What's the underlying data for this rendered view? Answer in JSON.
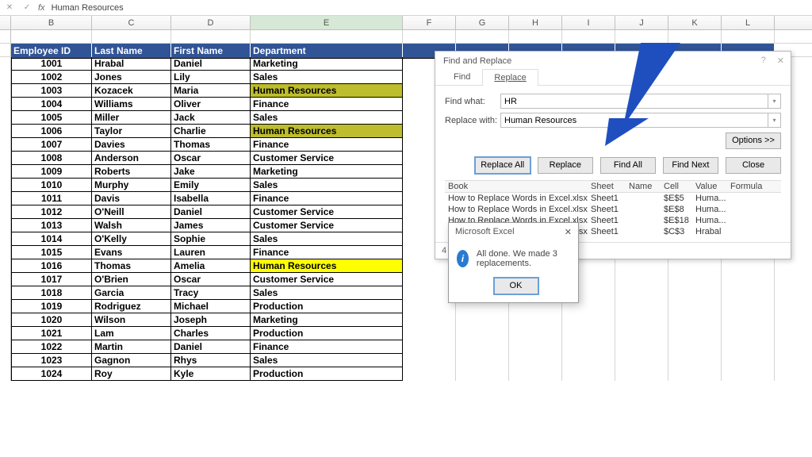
{
  "formula_bar": {
    "text": "Human Resources"
  },
  "columns": [
    "B",
    "C",
    "D",
    "E",
    "F",
    "G",
    "H",
    "I",
    "J",
    "K",
    "L"
  ],
  "headers": {
    "b": "Employee ID",
    "c": "Last Name",
    "d": "First Name",
    "e": "Department"
  },
  "rows": [
    {
      "id": "1001",
      "last": "Hrabal",
      "first": "Daniel",
      "dept": "Marketing"
    },
    {
      "id": "1002",
      "last": "Jones",
      "first": "Lily",
      "dept": "Sales"
    },
    {
      "id": "1003",
      "last": "Kozacek",
      "first": "Maria",
      "dept": "Human Resources",
      "hl": "olive"
    },
    {
      "id": "1004",
      "last": "Williams",
      "first": "Oliver",
      "dept": "Finance"
    },
    {
      "id": "1005",
      "last": "Miller",
      "first": "Jack",
      "dept": "Sales"
    },
    {
      "id": "1006",
      "last": "Taylor",
      "first": "Charlie",
      "dept": "Human Resources",
      "hl": "olive"
    },
    {
      "id": "1007",
      "last": "Davies",
      "first": "Thomas",
      "dept": "Finance"
    },
    {
      "id": "1008",
      "last": "Anderson",
      "first": "Oscar",
      "dept": "Customer Service"
    },
    {
      "id": "1009",
      "last": "Roberts",
      "first": "Jake",
      "dept": "Marketing"
    },
    {
      "id": "1010",
      "last": "Murphy",
      "first": "Emily",
      "dept": "Sales"
    },
    {
      "id": "1011",
      "last": "Davis",
      "first": "Isabella",
      "dept": "Finance"
    },
    {
      "id": "1012",
      "last": "O'Neill",
      "first": "Daniel",
      "dept": "Customer Service"
    },
    {
      "id": "1013",
      "last": "Walsh",
      "first": "James",
      "dept": "Customer Service"
    },
    {
      "id": "1014",
      "last": "O'Kelly",
      "first": "Sophie",
      "dept": "Sales"
    },
    {
      "id": "1015",
      "last": "Evans",
      "first": "Lauren",
      "dept": "Finance"
    },
    {
      "id": "1016",
      "last": "Thomas",
      "first": "Amelia",
      "dept": "Human Resources",
      "hl": "yellow"
    },
    {
      "id": "1017",
      "last": "O'Brien",
      "first": "Oscar",
      "dept": "Customer Service"
    },
    {
      "id": "1018",
      "last": "Garcia",
      "first": "Tracy",
      "dept": "Sales"
    },
    {
      "id": "1019",
      "last": "Rodriguez",
      "first": "Michael",
      "dept": "Production"
    },
    {
      "id": "1020",
      "last": "Wilson",
      "first": "Joseph",
      "dept": "Marketing"
    },
    {
      "id": "1021",
      "last": "Lam",
      "first": "Charles",
      "dept": "Production"
    },
    {
      "id": "1022",
      "last": "Martin",
      "first": "Daniel",
      "dept": "Finance"
    },
    {
      "id": "1023",
      "last": "Gagnon",
      "first": "Rhys",
      "dept": "Sales"
    },
    {
      "id": "1024",
      "last": "Roy",
      "first": "Kyle",
      "dept": "Production"
    }
  ],
  "dialog": {
    "title": "Find and Replace",
    "tab_find": "Find",
    "tab_replace": "Replace",
    "find_label": "Find what:",
    "find_value": "HR",
    "replace_label": "Replace with:",
    "replace_value": "Human Resources",
    "options": "Options >>",
    "btn_replace_all": "Replace All",
    "btn_replace": "Replace",
    "btn_find_all": "Find All",
    "btn_find_next": "Find Next",
    "btn_close": "Close",
    "footer": "4 cell(s) ",
    "cols": {
      "book": "Book",
      "sheet": "Sheet",
      "name": "Name",
      "cell": "Cell",
      "value": "Value",
      "formula": "Formula"
    },
    "results": [
      {
        "book": "How to Replace Words in Excel.xlsx",
        "sheet": "Sheet1",
        "name": "",
        "cell": "$E$5",
        "value": "Huma..."
      },
      {
        "book": "How to Replace Words in Excel.xlsx",
        "sheet": "Sheet1",
        "name": "",
        "cell": "$E$8",
        "value": "Huma..."
      },
      {
        "book": "How to Replace Words in Excel.xlsx",
        "sheet": "Sheet1",
        "name": "",
        "cell": "$E$18",
        "value": "Huma..."
      },
      {
        "book": "How to Replace Words in Excel.xlsx",
        "sheet": "Sheet1",
        "name": "",
        "cell": "$C$3",
        "value": "Hrabal"
      }
    ]
  },
  "msgbox": {
    "title": "Microsoft Excel",
    "text": "All done. We made 3 replacements.",
    "ok": "OK"
  }
}
